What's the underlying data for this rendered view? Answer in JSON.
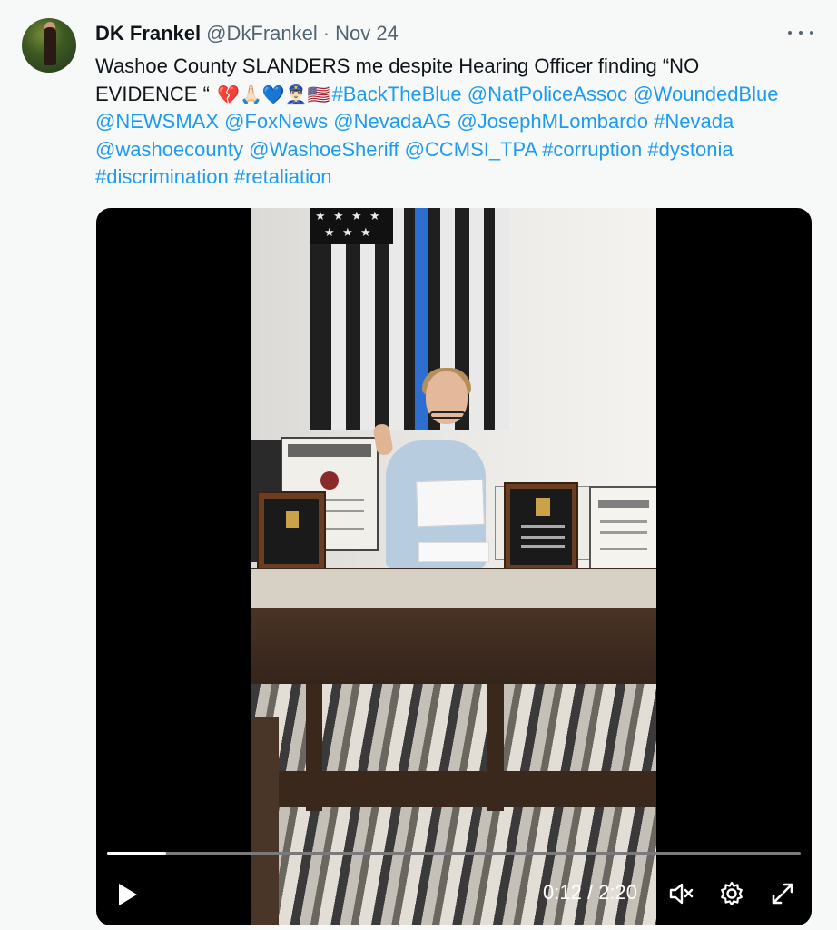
{
  "author": {
    "name": "DK Frankel",
    "handle": "@DkFrankel",
    "separator": "·",
    "date": "Nov 24"
  },
  "tweet": {
    "text_lead": "Washoe County SLANDERS me despite Hearing Officer finding “NO EVIDENCE “",
    "emojis": "💔🙏🏻💙👮🏻‍♂️🇺🇸",
    "tags": [
      "#BackTheBlue",
      "@NatPoliceAssoc",
      "@WoundedBlue",
      "@NEWSMAX",
      "@FoxNews",
      "@NevadaAG",
      "@JosephMLombardo",
      "#Nevada",
      "@washoecounty",
      "@WashoeSheriff",
      "@CCMSI_TPA",
      "#corruption",
      "#dystonia",
      "#discrimination",
      "#retaliation"
    ]
  },
  "video": {
    "current_time": "0:12",
    "duration": "2:20",
    "time_separator": "/",
    "progress_fraction": 0.0857,
    "controls": {
      "play": "play-icon",
      "mute": "volume-muted-icon",
      "settings": "gear-icon",
      "fullscreen": "expand-icon"
    }
  },
  "colors": {
    "link": "#1d9bf0",
    "text": "#0f1419",
    "muted": "#536471",
    "background": "#f7f9f9"
  }
}
